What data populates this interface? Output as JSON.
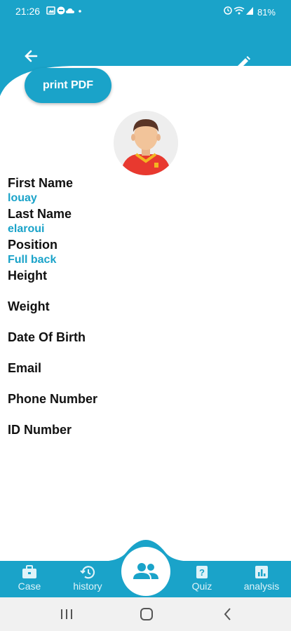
{
  "status_bar": {
    "time": "21:26",
    "icons": [
      "image-icon",
      "message-icon",
      "cloud-icon",
      "dot-icon"
    ],
    "battery": "81%"
  },
  "header": {
    "back_icon": "arrow-left-icon",
    "edit_icon": "pencil-icon",
    "print_label": "print PDF",
    "accent": "#1aa3c9"
  },
  "profile": {
    "avatar_icon": "football-player-avatar",
    "fields": [
      {
        "label": "First Name",
        "value": "louay"
      },
      {
        "label": "Last Name",
        "value": "elaroui"
      },
      {
        "label": "Position",
        "value": "Full back"
      },
      {
        "label": "Height",
        "value": ""
      },
      {
        "label": "Weight",
        "value": ""
      },
      {
        "label": "Date Of Birth",
        "value": ""
      },
      {
        "label": "Email",
        "value": ""
      },
      {
        "label": "Phone Number",
        "value": ""
      },
      {
        "label": "ID Number",
        "value": ""
      }
    ]
  },
  "bottom_nav": {
    "items": [
      {
        "label": "Case",
        "icon": "briefcase-icon"
      },
      {
        "label": "history",
        "icon": "history-icon"
      },
      {
        "label": "Quiz",
        "icon": "quiz-icon"
      },
      {
        "label": "analysis",
        "icon": "analysis-icon"
      }
    ],
    "center_icon": "people-icon"
  },
  "system_nav": [
    "recents-icon",
    "home-icon",
    "back-icon"
  ]
}
